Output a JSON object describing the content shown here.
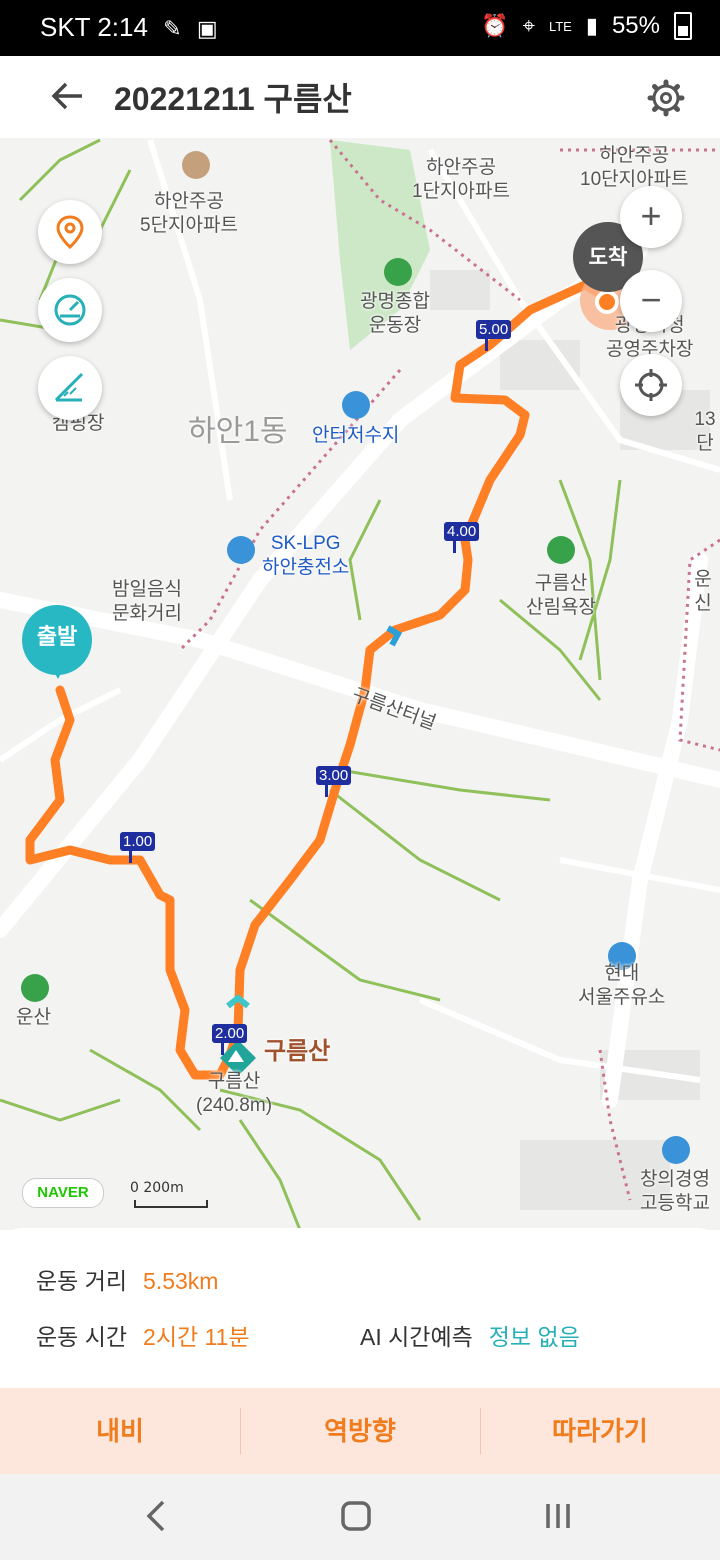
{
  "status_bar": {
    "carrier_time": "SKT 2:14",
    "network": "LTE",
    "battery": "55%"
  },
  "header": {
    "title": "20221211 구름산"
  },
  "map": {
    "labels": {
      "hanan5": "하안주공\n5단지아파트",
      "hanan1apt": "하안주공\n1단지아파트",
      "hanan10": "하안주공\n10단지아파트",
      "stadium": "광명종합\n운동장",
      "district": "하안1동",
      "reservoir": "안터저수지",
      "lpg": "SK-LPG\n하안충전소",
      "camping": "캠핑장",
      "food_street": "밤일음식\n문화거리",
      "forest": "구름산\n산림욕장",
      "tunnel": "구름산터널",
      "parking": "광명시청\n공영주차장",
      "unsan": "운산",
      "hyundai": "현대\n서울주유소",
      "peak_name": "구름산",
      "peak_detail": "구름산\n(240.8m)",
      "school": "창의경영\n고등학교",
      "far_right_1": "13단",
      "far_right_2": "운신"
    },
    "arrival_label": "도착",
    "start_label": "출발",
    "zoom_in": "+",
    "zoom_out": "−",
    "km_markers": [
      "1.00",
      "2.00",
      "3.00",
      "4.00",
      "5.00"
    ],
    "naver_logo": "NAVER",
    "scale_label": "0     200m"
  },
  "stats": {
    "distance_label": "운동 거리",
    "distance_value": "5.53km",
    "time_label": "운동 시간",
    "time_value": "2시간 11분",
    "ai_label": "AI 시간예측",
    "ai_value": "정보 없음"
  },
  "actions": {
    "navi": "내비",
    "reverse": "역방향",
    "follow": "따라가기"
  },
  "colors": {
    "route": "#ff7f24",
    "accent_orange": "#f07c1e",
    "accent_teal": "#27b0b8"
  }
}
